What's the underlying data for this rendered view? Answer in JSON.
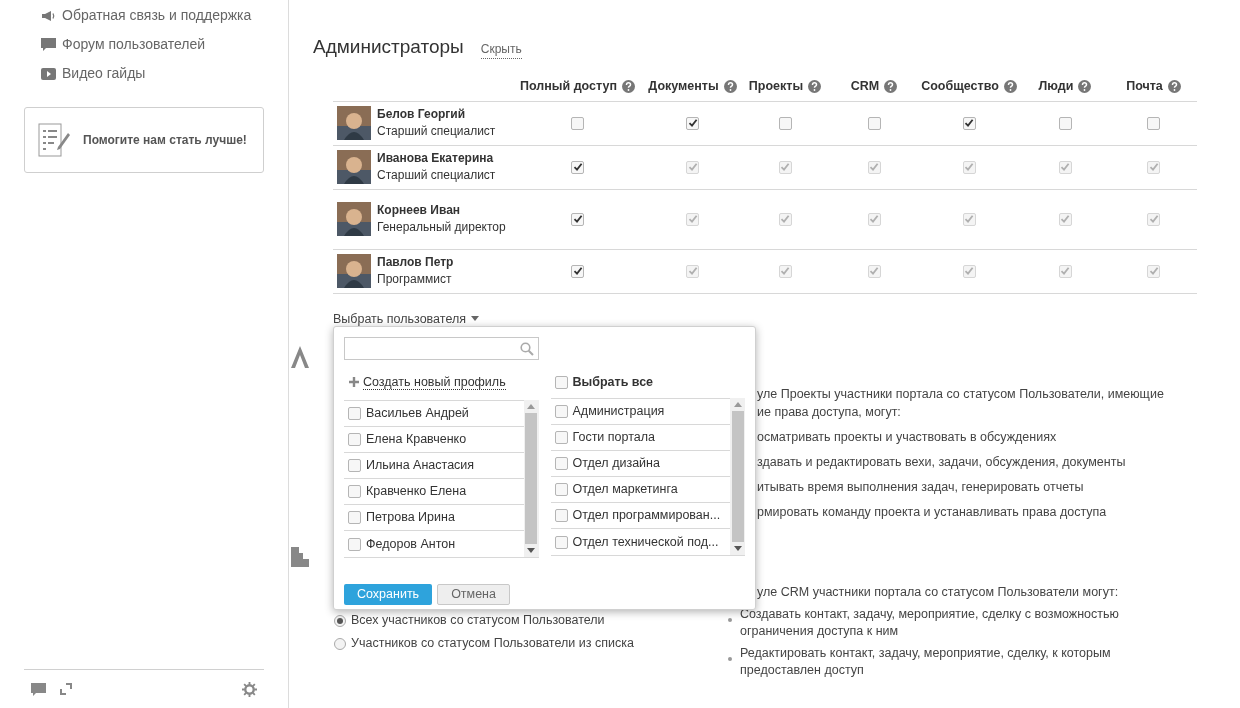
{
  "sidebar": {
    "links": [
      {
        "kind": "megaphone",
        "label": "Обратная связь и поддержка"
      },
      {
        "kind": "comment",
        "label": "Форум пользователей"
      },
      {
        "kind": "video",
        "label": "Видео гайды"
      }
    ],
    "help_card": {
      "label": "Помогите нам стать лучше!"
    }
  },
  "admins": {
    "title": "Администраторы",
    "hide_link": "Скрыть",
    "columns": [
      "Полный доступ",
      "Документы",
      "Проекты",
      "CRM",
      "Сообщество",
      "Люди",
      "Почта"
    ],
    "rows": [
      {
        "name": "Белов Георгий",
        "position": "Старший специалист",
        "permissions": [
          {
            "checked": false,
            "disabled": false
          },
          {
            "checked": true,
            "disabled": false
          },
          {
            "checked": false,
            "disabled": false
          },
          {
            "checked": false,
            "disabled": false
          },
          {
            "checked": true,
            "disabled": false
          },
          {
            "checked": false,
            "disabled": false
          },
          {
            "checked": false,
            "disabled": false
          }
        ]
      },
      {
        "name": "Иванова Екатерина",
        "position": "Старший специалист",
        "permissions": [
          {
            "checked": true,
            "disabled": false
          },
          {
            "checked": true,
            "disabled": true
          },
          {
            "checked": true,
            "disabled": true
          },
          {
            "checked": true,
            "disabled": true
          },
          {
            "checked": true,
            "disabled": true
          },
          {
            "checked": true,
            "disabled": true
          },
          {
            "checked": true,
            "disabled": true
          }
        ]
      },
      {
        "name": "Корнеев Иван",
        "position": "Генеральный директор",
        "permissions": [
          {
            "checked": true,
            "disabled": false
          },
          {
            "checked": true,
            "disabled": true
          },
          {
            "checked": true,
            "disabled": true
          },
          {
            "checked": true,
            "disabled": true
          },
          {
            "checked": true,
            "disabled": true
          },
          {
            "checked": true,
            "disabled": true
          },
          {
            "checked": true,
            "disabled": true
          }
        ]
      },
      {
        "name": "Павлов Петр",
        "position": "Программист",
        "permissions": [
          {
            "checked": true,
            "disabled": false
          },
          {
            "checked": true,
            "disabled": true
          },
          {
            "checked": true,
            "disabled": true
          },
          {
            "checked": true,
            "disabled": true
          },
          {
            "checked": true,
            "disabled": true
          },
          {
            "checked": true,
            "disabled": true
          },
          {
            "checked": true,
            "disabled": true
          }
        ]
      }
    ],
    "select_user": "Выбрать пользователя"
  },
  "popup": {
    "create_profile": "Создать новый профиль",
    "select_all": {
      "label": "Выбрать все",
      "checked": false
    },
    "users": [
      {
        "name": "Васильев Андрей",
        "checked": false
      },
      {
        "name": "Елена Кравченко",
        "checked": false
      },
      {
        "name": "Ильина Анастасия",
        "checked": false
      },
      {
        "name": "Кравченко Елена",
        "checked": false
      },
      {
        "name": "Петрова Ирина",
        "checked": false
      },
      {
        "name": "Федоров Антон",
        "checked": false
      }
    ],
    "groups": [
      {
        "name": "Администрация",
        "checked": false
      },
      {
        "name": "Гости портала",
        "checked": false
      },
      {
        "name": "Отдел дизайна",
        "checked": false
      },
      {
        "name": "Отдел маркетинга",
        "checked": false
      },
      {
        "name": "Отдел программирован...",
        "checked": false
      },
      {
        "name": "Отдел технической под...",
        "checked": false
      }
    ],
    "save": "Сохранить",
    "cancel": "Отмена"
  },
  "projects_section": {
    "intro": [
      "уле Проекты участники портала со статусом Пользователи, имеющие",
      "ие права доступа, могут:"
    ],
    "items": [
      "осматривать проекты и участвовать в обсуждениях",
      "здавать и редактировать вехи, задачи, обсуждения, документы",
      "итывать время выполнения задач, генерировать отчеты",
      "рмировать команду проекта и устанавливать права доступа"
    ]
  },
  "crm_section": {
    "intro": "уле CRM участники портала со статусом Пользователи могут:",
    "items": [
      "Создавать контакт, задачу, мероприятие, сделку с возможностью ограничения доступа к ним",
      "Редактировать контакт, задачу, мероприятие, сделку, к которым предоставлен доступ"
    ]
  },
  "access_options": [
    {
      "label": "Всех участников со статусом Пользователи",
      "selected": true
    },
    {
      "label": "Участников со статусом Пользователи из списка",
      "selected": false
    }
  ]
}
